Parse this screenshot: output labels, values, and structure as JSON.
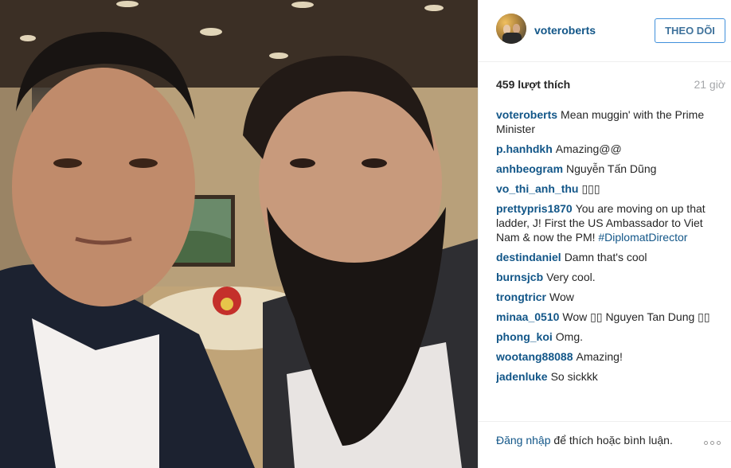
{
  "post": {
    "photo_alt": "",
    "author": {
      "username": "voteroberts",
      "avatar_icon": "profile-photo-icon"
    },
    "follow_label": "THEO DÕI",
    "likes_text": "459 lượt thích",
    "time_text": "21 giờ",
    "caption": {
      "user": "voteroberts",
      "text": "Mean muggin' with the Prime Minister"
    },
    "comments": [
      {
        "user": "p.hanhdkh",
        "text": "Amazing@@"
      },
      {
        "user": "anhbeogram",
        "text": "Nguyễn Tấn Dũng"
      },
      {
        "user": "vo_thi_anh_thu",
        "text": "▯▯▯"
      },
      {
        "user": "prettypris1870",
        "text": "You are moving on up that ladder, J! First the US Ambassador to Viet Nam & now the PM!",
        "hashtag": "#DiplomatDirector"
      },
      {
        "user": "destindaniel",
        "text": "Damn that's cool"
      },
      {
        "user": "burnsjcb",
        "text": "Very cool."
      },
      {
        "user": "trongtricr",
        "text": "Wow"
      },
      {
        "user": "minaa_0510",
        "text": "Wow ▯▯ Nguyen Tan Dung ▯▯"
      },
      {
        "user": "phong_koi",
        "text": "Omg."
      },
      {
        "user": "wootang88088",
        "text": "Amazing!"
      },
      {
        "user": "jadenluke",
        "text": "So sickkk"
      }
    ],
    "footer": {
      "login_link": "Đăng nhập",
      "login_rest": " để thích hoặc bình luận.",
      "more_icon": "more-options-icon"
    }
  },
  "colors": {
    "link_blue": "#125688",
    "follow_border": "#4090db",
    "follow_text": "#3f729b",
    "muted": "#a5a7aa"
  }
}
